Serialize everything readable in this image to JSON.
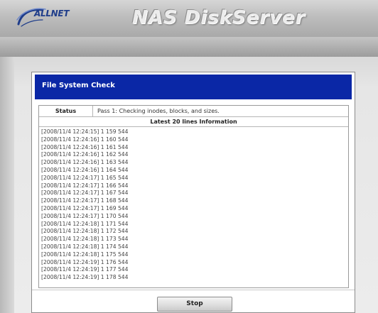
{
  "header": {
    "logo_text": "ALLNET",
    "product_title": "NAS DiskServer"
  },
  "panel": {
    "title": "File System Check",
    "status_label": "Status",
    "status_value": "Pass 1: Checking inodes, blocks, and sizes.",
    "log_header": "Latest 20 lines Information",
    "log_lines": [
      "[2008/11/4 12:24:15] 1 159 544",
      "[2008/11/4 12:24:16] 1 160 544",
      "[2008/11/4 12:24:16] 1 161 544",
      "[2008/11/4 12:24:16] 1 162 544",
      "[2008/11/4 12:24:16] 1 163 544",
      "[2008/11/4 12:24:16] 1 164 544",
      "[2008/11/4 12:24:17] 1 165 544",
      "[2008/11/4 12:24:17] 1 166 544",
      "[2008/11/4 12:24:17] 1 167 544",
      "[2008/11/4 12:24:17] 1 168 544",
      "[2008/11/4 12:24:17] 1 169 544",
      "[2008/11/4 12:24:17] 1 170 544",
      "[2008/11/4 12:24:18] 1 171 544",
      "[2008/11/4 12:24:18] 1 172 544",
      "[2008/11/4 12:24:18] 1 173 544",
      "[2008/11/4 12:24:18] 1 174 544",
      "[2008/11/4 12:24:18] 1 175 544",
      "[2008/11/4 12:24:19] 1 176 544",
      "[2008/11/4 12:24:19] 1 177 544",
      "[2008/11/4 12:24:19] 1 178 544"
    ],
    "stop_label": "Stop"
  },
  "colors": {
    "panel_header_bg": "#0a27a6",
    "logo_blue": "#1f3d8a"
  }
}
